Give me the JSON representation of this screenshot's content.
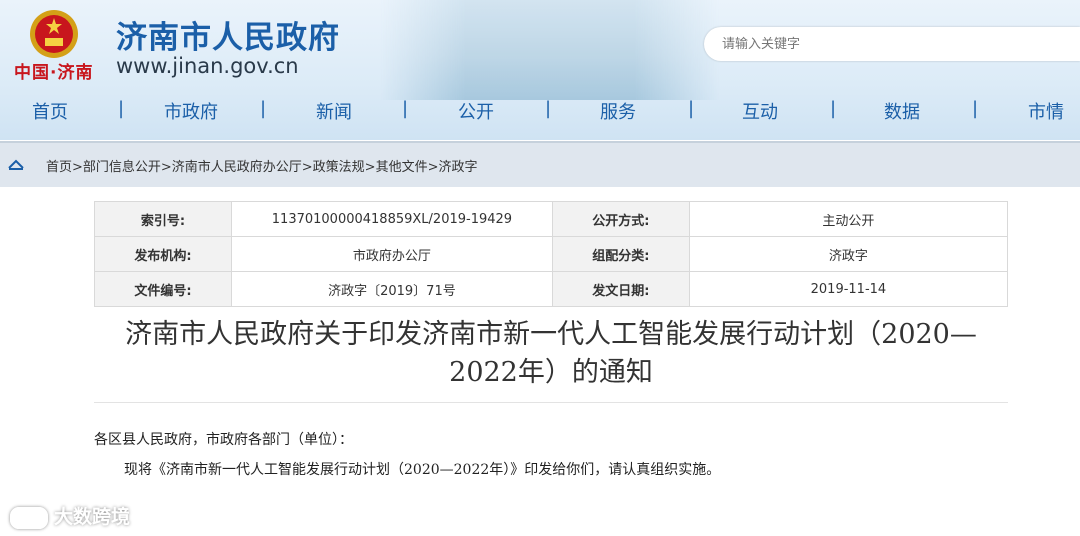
{
  "header": {
    "emblem_text": "中国·济南",
    "site_title": "济南市人民政府",
    "site_url": "www.jinan.gov.cn",
    "search_placeholder": "请输入关键字"
  },
  "nav": [
    "首页",
    "市政府",
    "新闻",
    "公开",
    "服务",
    "互动",
    "数据",
    "市情"
  ],
  "breadcrumb": "首页>部门信息公开>济南市人民政府办公厅>政策法规>其他文件>济政字",
  "info": {
    "index_label": "索引号:",
    "index_value": "11370100000418859XL/2019-19429",
    "public_mode_label": "公开方式:",
    "public_mode_value": "主动公开",
    "publisher_label": "发布机构:",
    "publisher_value": "市政府办公厅",
    "category_label": "组配分类:",
    "category_value": "济政字",
    "doc_no_label": "文件编号:",
    "doc_no_value": "济政字〔2019〕71号",
    "date_label": "发文日期:",
    "date_value": "2019-11-14"
  },
  "doc": {
    "title_line1": "济南市人民政府关于印发济南市新一代人工智能发展行动计划（2020—",
    "title_line2": "2022年）的通知",
    "salutation": "各区县人民政府，市政府各部门（单位）：",
    "paragraph1": "现将《济南市新一代人工智能发展行动计划（2020—2022年）》印发给你们，请认真组织实施。"
  },
  "watermark": "大数跨境",
  "colors": {
    "brand_blue": "#1b5fa8",
    "emblem_red": "#c8161d"
  }
}
